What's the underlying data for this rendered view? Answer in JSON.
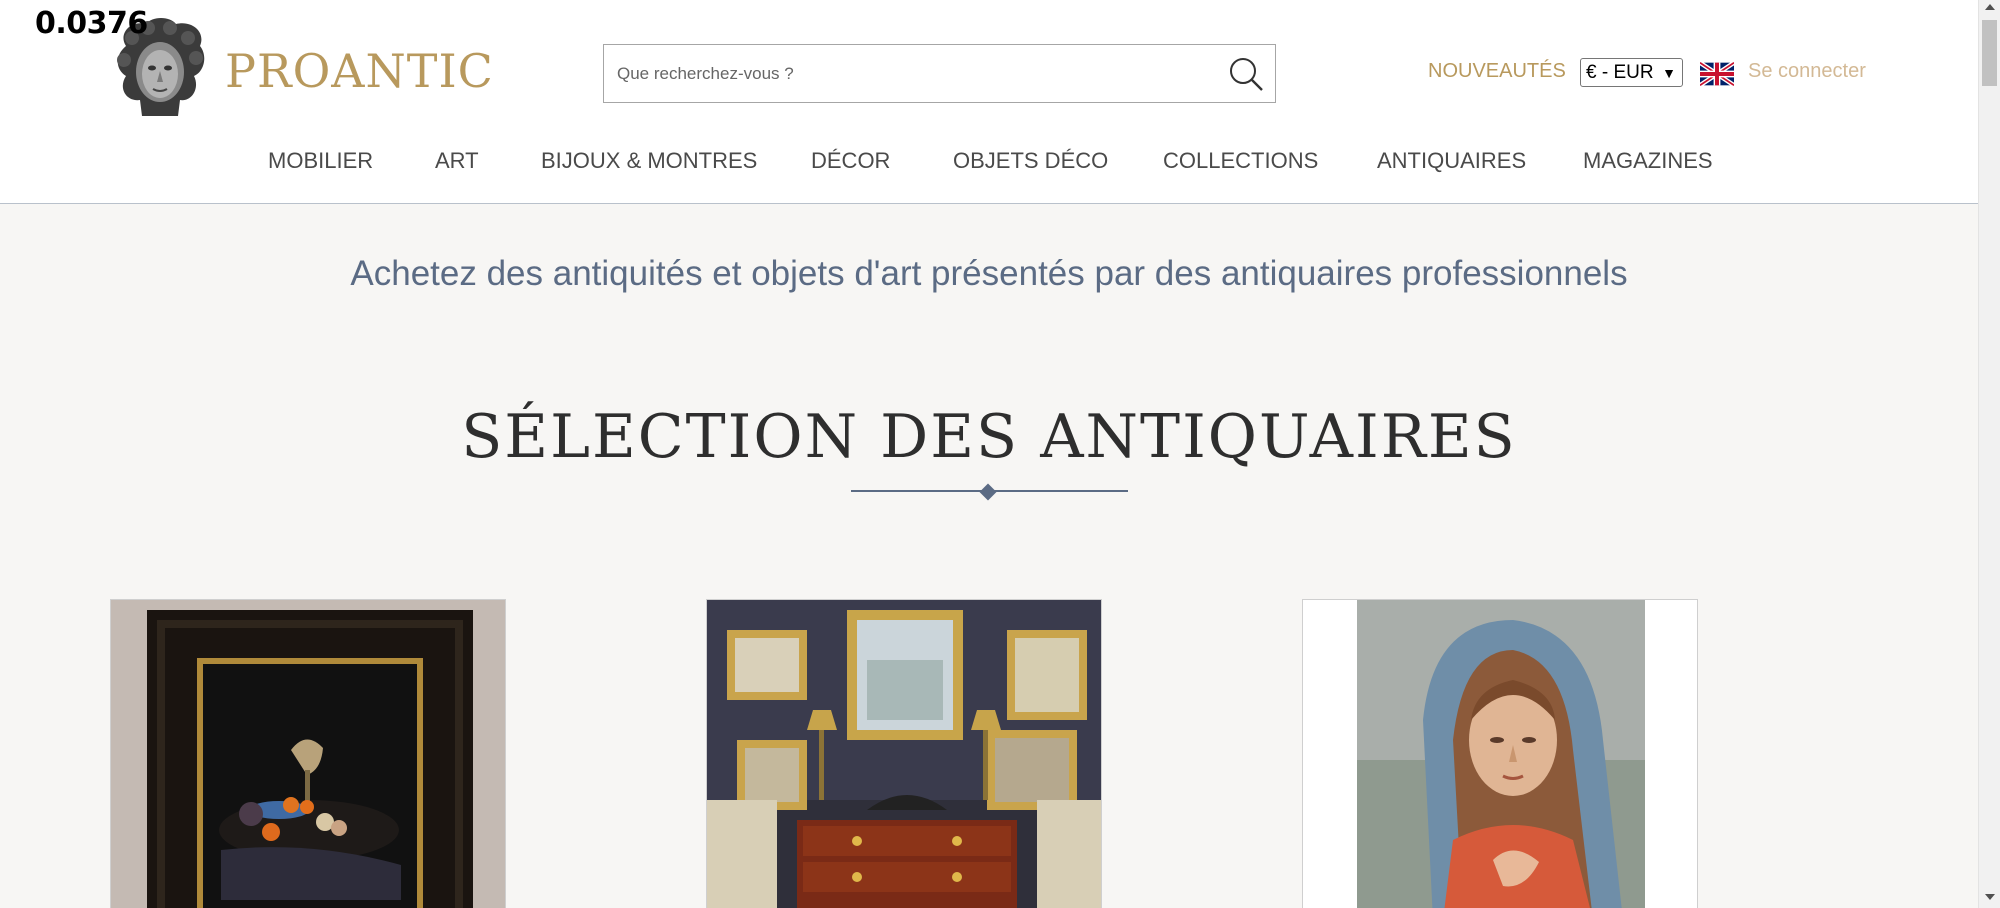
{
  "overlay": {
    "value": "0.0376"
  },
  "header": {
    "logo_text": "PROANTIC",
    "search_placeholder": "Que recherchez-vous ?",
    "nouveautes": "NOUVEAUTÉS",
    "currency_selected": "€ - EUR",
    "language_flag": "uk-flag-icon",
    "login": "Se connecter"
  },
  "nav": {
    "items": [
      "MOBILIER",
      "ART",
      "BIJOUX & MONTRES",
      "DÉCOR",
      "OBJETS DÉCO",
      "COLLECTIONS",
      "ANTIQUAIRES",
      "MAGAZINES"
    ]
  },
  "main": {
    "tagline": "Achetez des antiquités et objets d'art présentés par des antiquaires professionnels",
    "section_title": "SÉLECTION DES ANTIQUAIRES"
  },
  "colors": {
    "brand_gold": "#b8995d",
    "accent_slate": "#5b6b84",
    "background": "#f7f6f4"
  }
}
